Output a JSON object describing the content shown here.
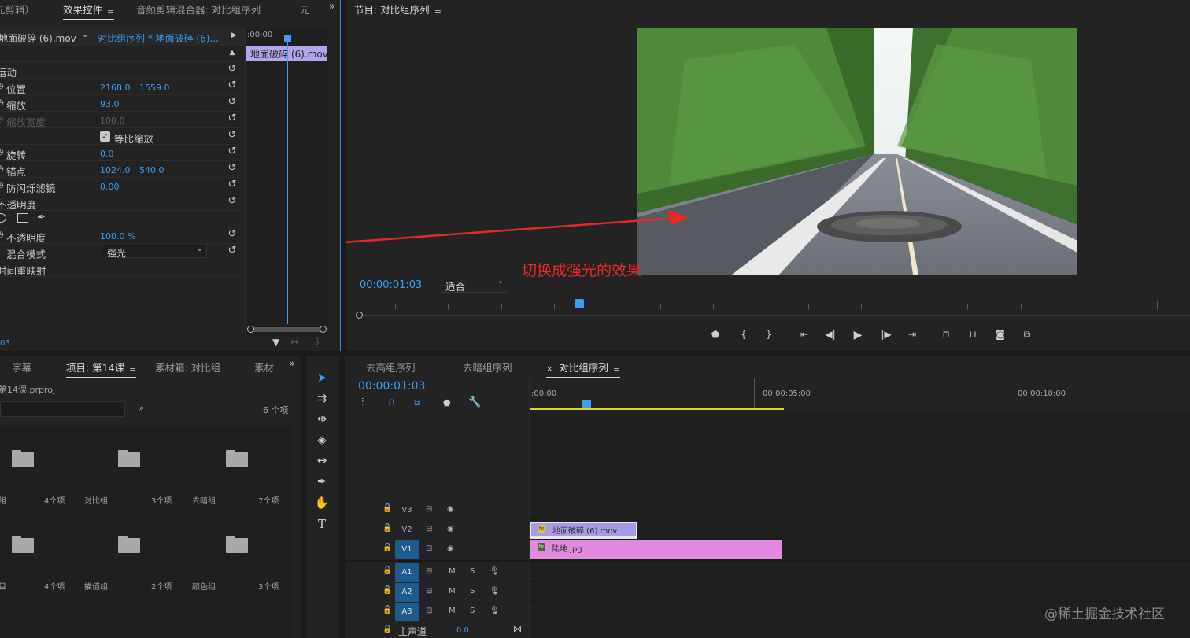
{
  "effect_controls": {
    "tabs": [
      {
        "label": "元剪辑）"
      },
      {
        "label": "效果控件",
        "menu": "≡"
      },
      {
        "label": "音频剪辑混合器: 对比组序列"
      },
      {
        "label": "元"
      }
    ],
    "expand": "»",
    "source_clip": "地面破碎 (6).mov",
    "sequence_clip": "对比组序列 * 地面破碎 (6)...",
    "timecode_head": ":00:00",
    "clip_label": "地面破碎 (6).mov",
    "rows": [
      {
        "label": "运动"
      },
      {
        "label": "位置",
        "v1": "2168.0",
        "v2": "1559.0"
      },
      {
        "label": "缩放",
        "v1": "93.0"
      },
      {
        "label": "缩放宽度",
        "v1": "100.0"
      },
      {
        "label": "等比缩放"
      },
      {
        "label": "旋转",
        "v1": "0.0"
      },
      {
        "label": "锚点",
        "v1": "1024.0",
        "v2": "540.0"
      },
      {
        "label": "防闪烁滤镜",
        "v1": "0.00"
      },
      {
        "label": "不透明度"
      },
      {
        "label": ""
      },
      {
        "label": "不透明度",
        "v1": "100.0 %"
      },
      {
        "label": "混合模式",
        "select": "强光"
      },
      {
        "label": "时间重映射"
      }
    ],
    "footer_timecode": "03"
  },
  "program_monitor": {
    "title": "节目: 对比组序列",
    "menu": "≡",
    "timecode": "00:00:01:03",
    "fit": "适合",
    "annotation": "切换成强光的效果",
    "controls": [
      "marker",
      "in",
      "out",
      "go-in",
      "step-back",
      "play",
      "step-forward",
      "go-out",
      "lift",
      "extract",
      "camera",
      "compare"
    ]
  },
  "project_panel": {
    "tabs": [
      {
        "label": "字幕"
      },
      {
        "label": "项目: 第14课",
        "menu": "≡"
      },
      {
        "label": "素材箱: 对比组"
      },
      {
        "label": "素材"
      }
    ],
    "expand": "»",
    "file": "第14课.prproj",
    "count": "6 个项",
    "bins": [
      {
        "name": "组",
        "count": "4个项"
      },
      {
        "name": "对比组",
        "count": "3个项"
      },
      {
        "name": "去暗组",
        "count": "7个项"
      },
      {
        "name": "目",
        "count": "4个项"
      },
      {
        "name": "描值组",
        "count": "2个项"
      },
      {
        "name": "颜色组",
        "count": "3个项"
      }
    ]
  },
  "timeline": {
    "tabs": [
      {
        "label": "去高组序列"
      },
      {
        "label": "去暗组序列"
      },
      {
        "label": "对比组序列",
        "close": "×",
        "menu": "≡"
      }
    ],
    "timecode": "00:00:01:03",
    "ruler": [
      ":00:00",
      "00:00:05:00",
      "00:00:10:00"
    ],
    "tracks": [
      {
        "name": "V3",
        "kind": "video"
      },
      {
        "name": "V2",
        "kind": "video"
      },
      {
        "name": "V1",
        "kind": "video",
        "targeted": true
      },
      {
        "name": "A1",
        "kind": "audio",
        "targeted": true
      },
      {
        "name": "A2",
        "kind": "audio",
        "targeted": true
      },
      {
        "name": "A3",
        "kind": "audio",
        "targeted": true
      }
    ],
    "mute": "M",
    "solo": "S",
    "clips": {
      "v2": {
        "label": "地面破碎 (6).mov",
        "fx": "fx",
        "color": "#a79be6"
      },
      "v1": {
        "label": "陆地.jpg",
        "fx": "fx",
        "color": "#e28ae0"
      }
    },
    "master": {
      "label": "主声道",
      "value": "0.0"
    }
  },
  "watermark": "@稀土掘金技术社区",
  "colors": {
    "accent": "#3d9cf5",
    "annotation": "#e52a27",
    "work_area": "#e0d51c"
  }
}
